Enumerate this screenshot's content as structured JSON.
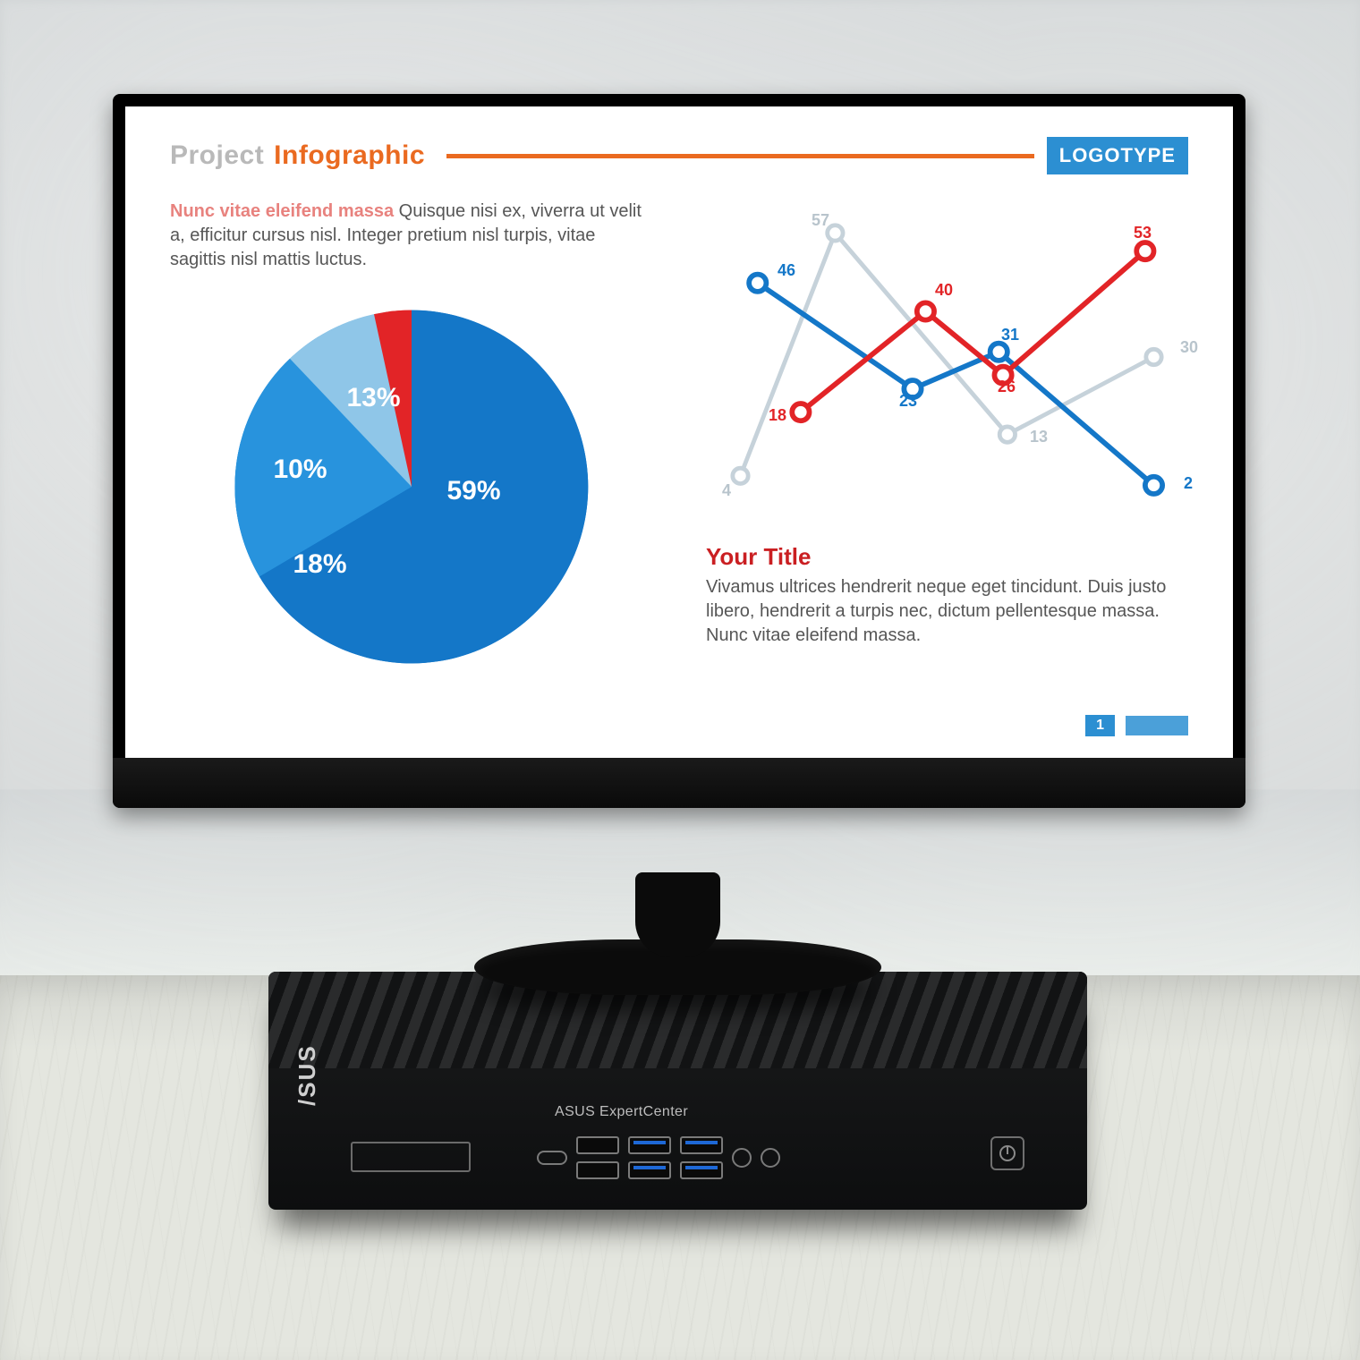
{
  "hardware": {
    "monitor_brand": "/SUS",
    "pc_brand": "/SUS",
    "pc_label": "ASUS ExpertCenter"
  },
  "slide": {
    "title_grey": "Project",
    "title_orange": "Infographic",
    "logo": "LOGOTYPE",
    "lead_highlight": "Nunc vitae eleifend massa",
    "lead_rest": "  Quisque nisi ex, viverra ut velit a, efficitur cursus nisl. Integer pretium nisl turpis, vitae sagittis nisl mattis luctus.",
    "sub_title": "Your Title",
    "sub_text": "Vivamus ultrices hendrerit neque eget tincidunt. Duis justo libero, hendrerit a turpis nec, dictum pellentesque massa. Nunc vitae eleifend massa.",
    "page": "1",
    "pie_labels": {
      "p59": "59%",
      "p18": "18%",
      "p10": "10%",
      "p13": "13%"
    },
    "line_labels": {
      "b46": "46",
      "b23": "23",
      "b31": "31",
      "b2": "2",
      "r18": "18",
      "r40": "40",
      "r26": "26",
      "r53": "53",
      "g4": "4",
      "g57": "57",
      "g13": "13",
      "g30": "30"
    }
  },
  "chart_data": [
    {
      "type": "pie",
      "title": "",
      "slices": [
        {
          "label": "59%",
          "value": 59,
          "color": "#1477c8"
        },
        {
          "label": "18%",
          "value": 18,
          "color": "#2893dd"
        },
        {
          "label": "10%",
          "value": 10,
          "color": "#8fc6e8"
        },
        {
          "label": "13%",
          "value": 13,
          "color": "#e22427"
        }
      ]
    },
    {
      "type": "line",
      "title": "",
      "x": [
        1,
        2,
        3,
        4,
        5,
        6
      ],
      "categories": [
        "",
        "",
        "",
        "",
        "",
        ""
      ],
      "ylim": [
        0,
        60
      ],
      "xlabel": "",
      "ylabel": "",
      "series": [
        {
          "name": "blue",
          "color": "#1477c8",
          "values": [
            46,
            null,
            23,
            31,
            null,
            2
          ]
        },
        {
          "name": "red",
          "color": "#e22427",
          "values": [
            null,
            18,
            40,
            26,
            null,
            53
          ]
        },
        {
          "name": "grey",
          "color": "#c6d2da",
          "values": [
            4,
            57,
            null,
            13,
            null,
            30
          ]
        }
      ]
    }
  ]
}
